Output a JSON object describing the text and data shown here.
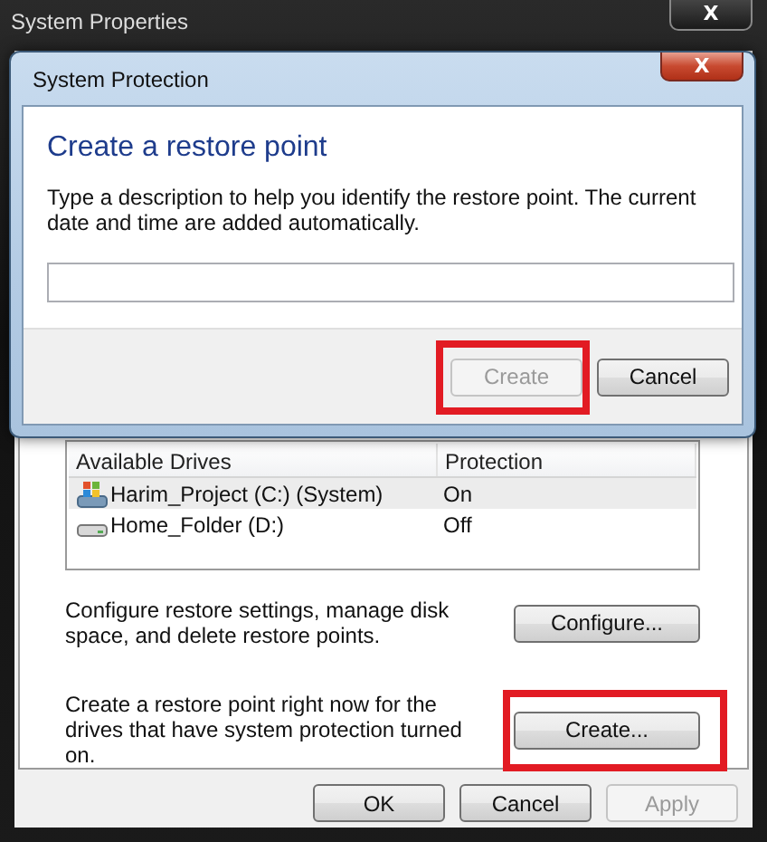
{
  "window": {
    "title": "System Properties",
    "close": "X"
  },
  "drives": {
    "columns": [
      "Available Drives",
      "Protection"
    ],
    "rows": [
      {
        "name": "Harim_Project (C:) (System)",
        "protection": "On",
        "kind": "system",
        "selected": true
      },
      {
        "name": "Home_Folder (D:)",
        "protection": "Off",
        "kind": "disk",
        "selected": false
      }
    ]
  },
  "configure": {
    "text": "Configure restore settings, manage disk space, and delete restore points.",
    "button": {
      "label": "Configure...",
      "disabled": false
    }
  },
  "create": {
    "text": "Create a restore point right now for the drives that have system protection turned on.",
    "button": {
      "label": "Create...",
      "disabled": false,
      "highlighted": true
    }
  },
  "buttons": [
    {
      "label": "OK",
      "disabled": false
    },
    {
      "label": "Cancel",
      "disabled": false
    },
    {
      "label": "Apply",
      "disabled": true
    }
  ],
  "dialog": {
    "title": "System Protection",
    "close": "X",
    "heading": "Create a restore point",
    "description": "Type a description to help you identify the restore point. The current date and time are added automatically.",
    "buttons": [
      {
        "label": "Create",
        "disabled": true,
        "highlighted": true
      },
      {
        "label": "Cancel",
        "disabled": false
      }
    ]
  }
}
